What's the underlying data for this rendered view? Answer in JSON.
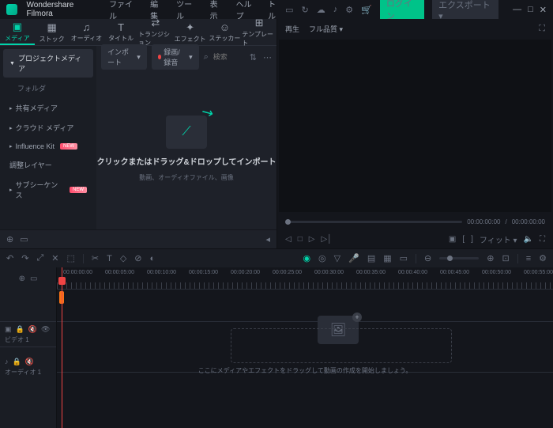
{
  "app": {
    "name": "Wondershare Filmora",
    "title": "タイトルなし"
  },
  "menu": {
    "file": "ファイル",
    "edit": "編集",
    "tools": "ツール",
    "view": "表示",
    "help": "ヘルプ"
  },
  "titlebar": {
    "login": "ログイン",
    "export": "エクスポート ▾"
  },
  "tabs": {
    "media": "メディア",
    "stock": "ストック",
    "audio": "オーディオ",
    "title": "タイトル",
    "transition": "トランジション",
    "effect": "エフェクト",
    "sticker": "ステッカー",
    "template": "テンプレート"
  },
  "sidebar": {
    "project_media": "プロジェクトメディア",
    "folder": "フォルダ",
    "shared": "共有メディア",
    "cloud": "クラウド メディア",
    "influence": "Influence Kit",
    "adjust": "調整レイヤー",
    "subsequence": "サブシーケンス",
    "new_badge": "NEW"
  },
  "content": {
    "import": "インポート",
    "record": "録画/録音",
    "search_placeholder": "検索"
  },
  "drop": {
    "title": "クリックまたはドラッグ&ドロップしてインポート",
    "sub": "動画、オーディオファイル、画像"
  },
  "preview": {
    "playback": "再生",
    "quality": "フル品質",
    "time_current": "00:00:00:00",
    "time_total": "00:00:00:00",
    "fit": "フィット"
  },
  "timeline": {
    "ticks": [
      "00:00:00:00",
      "00:00:05:00",
      "00:00:10:00",
      "00:00:15:00",
      "00:00:20:00",
      "00:00:25:00",
      "00:00:30:00",
      "00:00:35:00",
      "00:00:40:00",
      "00:00:45:00",
      "00:00:50:00",
      "00:00:55:00"
    ],
    "video_label": "ビデオ 1",
    "audio_label": "オーディオ 1",
    "hint": "ここにメディアやエフェクトをドラッグして動画の作成を開始しましょう。"
  }
}
